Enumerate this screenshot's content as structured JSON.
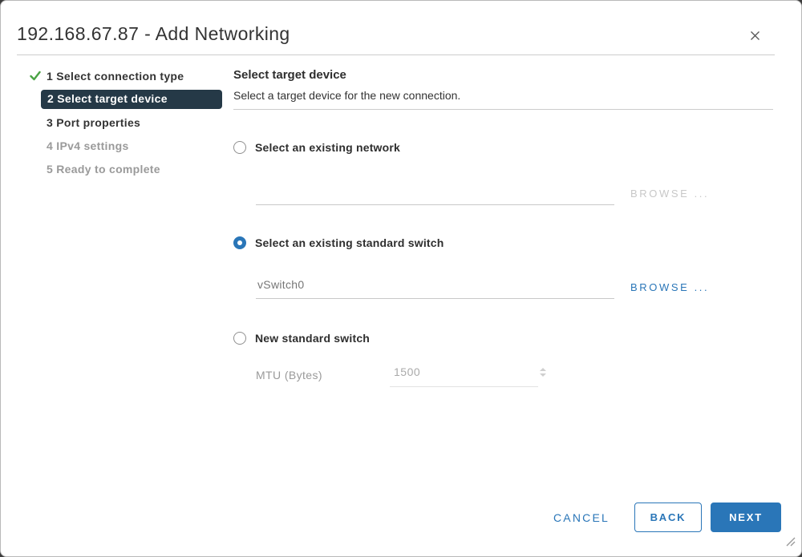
{
  "colors": {
    "accent_blue": "#2a76b8",
    "active_step_bg": "#253947",
    "success_green": "#4aa344",
    "disabled_gray": "#c8c8c8"
  },
  "dialog": {
    "title": "192.168.67.87 - Add Networking"
  },
  "wizard": {
    "steps": [
      {
        "label": "1 Select connection type",
        "state": "completed"
      },
      {
        "label": "2 Select target device",
        "state": "active"
      },
      {
        "label": "3 Port properties",
        "state": "upcoming"
      },
      {
        "label": "4 IPv4 settings",
        "state": "disabled"
      },
      {
        "label": "5 Ready to complete",
        "state": "disabled"
      }
    ]
  },
  "content": {
    "heading": "Select target device",
    "subtitle": "Select a target device for the new connection.",
    "option_existing_network": {
      "label": "Select an existing network",
      "selected": false,
      "value": "",
      "browse_label": "BROWSE ...",
      "browse_enabled": false
    },
    "option_existing_switch": {
      "label": "Select an existing standard switch",
      "selected": true,
      "value": "vSwitch0",
      "browse_label": "BROWSE ...",
      "browse_enabled": true
    },
    "option_new_switch": {
      "label": "New standard switch",
      "selected": false,
      "mtu_label": "MTU (Bytes)",
      "mtu_value": "1500"
    }
  },
  "footer": {
    "cancel_label": "CANCEL",
    "back_label": "BACK",
    "next_label": "NEXT"
  }
}
